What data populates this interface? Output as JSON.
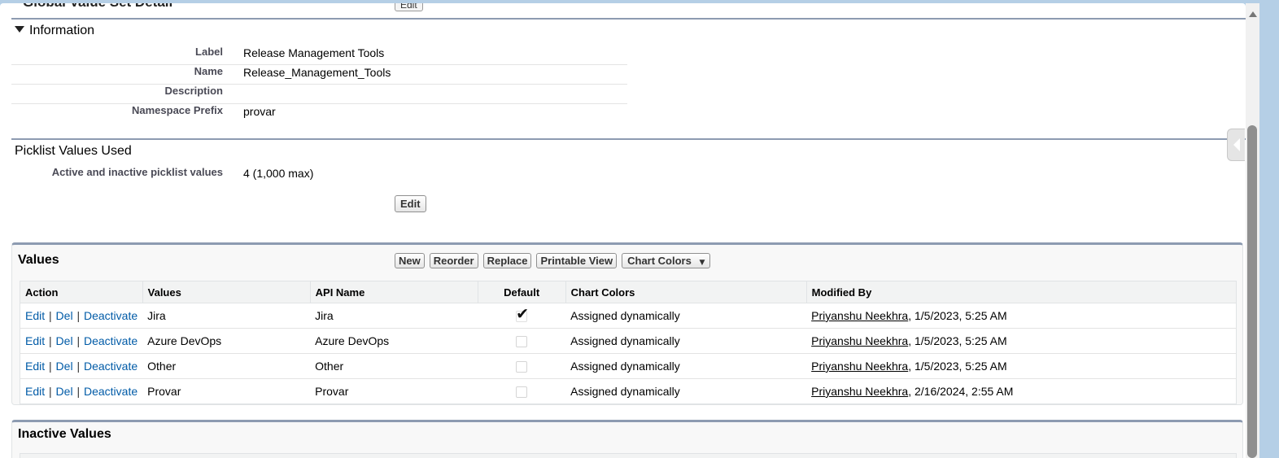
{
  "header": {
    "title": "Global Value Set Detail",
    "edit_label": "Edit"
  },
  "information": {
    "title": "Information",
    "fields": [
      {
        "label": "Label",
        "value": "Release Management Tools"
      },
      {
        "label": "Name",
        "value": "Release_Management_Tools"
      },
      {
        "label": "Description",
        "value": ""
      },
      {
        "label": "Namespace Prefix",
        "value": "provar"
      }
    ]
  },
  "picklist": {
    "title": "Picklist Values Used",
    "label": "Active and inactive picklist values",
    "value": "4 (1,000 max)",
    "edit_label": "Edit"
  },
  "values_panel": {
    "title": "Values",
    "buttons": {
      "new": "New",
      "reorder": "Reorder",
      "replace": "Replace",
      "printable": "Printable View",
      "chart_colors": "Chart Colors"
    },
    "columns": [
      "Action",
      "Values",
      "API Name",
      "Default",
      "Chart Colors",
      "Modified By"
    ],
    "actions": {
      "edit": "Edit",
      "del": "Del",
      "deactivate": "Deactivate",
      "sep": "|"
    },
    "rows": [
      {
        "value": "Jira",
        "api_name": "Jira",
        "default": true,
        "chart_color": "Assigned dynamically",
        "modified_user": "Priyanshu Neekhra",
        "modified_date": ", 1/5/2023, 5:25 AM"
      },
      {
        "value": "Azure DevOps",
        "api_name": "Azure DevOps",
        "default": false,
        "chart_color": "Assigned dynamically",
        "modified_user": "Priyanshu Neekhra",
        "modified_date": ", 1/5/2023, 5:25 AM"
      },
      {
        "value": "Other",
        "api_name": "Other",
        "default": false,
        "chart_color": "Assigned dynamically",
        "modified_user": "Priyanshu Neekhra",
        "modified_date": ", 1/5/2023, 5:25 AM"
      },
      {
        "value": "Provar",
        "api_name": "Provar",
        "default": false,
        "chart_color": "Assigned dynamically",
        "modified_user": "Priyanshu Neekhra",
        "modified_date": ", 2/16/2024, 2:55 AM"
      }
    ]
  },
  "inactive_panel": {
    "title": "Inactive Values"
  },
  "colors": {
    "link": "#015ba7",
    "section_border": "#8d9bb1",
    "page_bg": "#b5cfe6"
  }
}
